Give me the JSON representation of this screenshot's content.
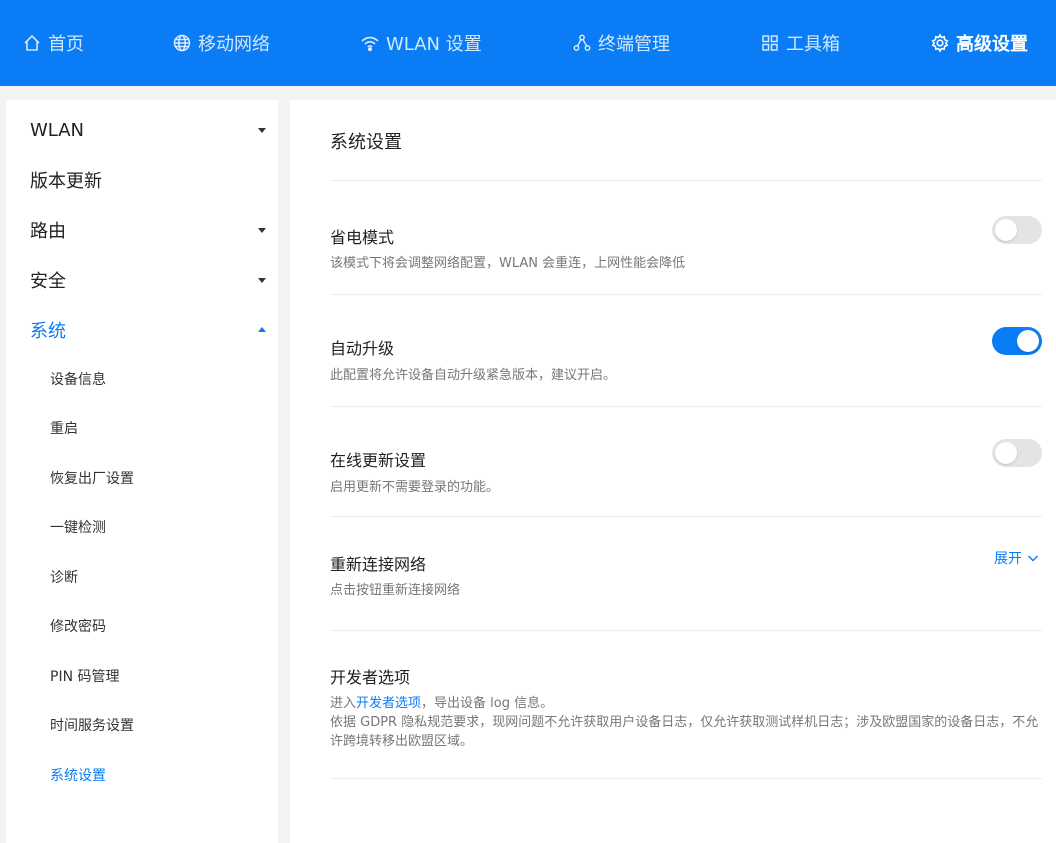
{
  "nav": {
    "items": [
      {
        "label": "首页",
        "icon": "home-icon"
      },
      {
        "label": "移动网络",
        "icon": "globe-icon"
      },
      {
        "label": "WLAN 设置",
        "icon": "wifi-icon"
      },
      {
        "label": "终端管理",
        "icon": "devices-icon"
      },
      {
        "label": "工具箱",
        "icon": "toolbox-icon"
      },
      {
        "label": "高级设置",
        "icon": "gear-icon"
      }
    ],
    "active": "高级设置"
  },
  "sidebar": {
    "items": [
      {
        "label": "WLAN"
      },
      {
        "label": "版本更新"
      },
      {
        "label": "路由"
      },
      {
        "label": "安全"
      },
      {
        "label": "系统"
      }
    ],
    "system_sub": [
      {
        "label": "设备信息"
      },
      {
        "label": "重启"
      },
      {
        "label": "恢复出厂设置"
      },
      {
        "label": "一键检测"
      },
      {
        "label": "诊断"
      },
      {
        "label": "修改密码"
      },
      {
        "label": "PIN 码管理"
      },
      {
        "label": "时间服务设置"
      },
      {
        "label": "系统设置"
      }
    ]
  },
  "main": {
    "title": "系统设置",
    "power_save": {
      "title": "省电模式",
      "desc": "该模式下将会调整网络配置，WLAN 会重连，上网性能会降低",
      "enabled": false
    },
    "auto_upgrade": {
      "title": "自动升级",
      "desc": "此配置将允许设备自动升级紧急版本，建议开启。",
      "enabled": true
    },
    "online_update": {
      "title": "在线更新设置",
      "desc": "启用更新不需要登录的功能。",
      "enabled": false
    },
    "reconnect": {
      "title": "重新连接网络",
      "desc": "点击按钮重新连接网络",
      "expand_label": "展开"
    },
    "developer": {
      "title": "开发者选项",
      "desc_prefix": "进入",
      "desc_link": "开发者选项",
      "desc_suffix": "，导出设备 log 信息。",
      "gdpr_note": "依据 GDPR 隐私规范要求，现网问题不允许获取用户设备日志，仅允许获取测试样机日志；涉及欧盟国家的设备日志，不允许跨境转移出欧盟区域。"
    }
  },
  "colors": {
    "accent": "#0a7cf5",
    "toggle_off": "#e3e4e6"
  }
}
